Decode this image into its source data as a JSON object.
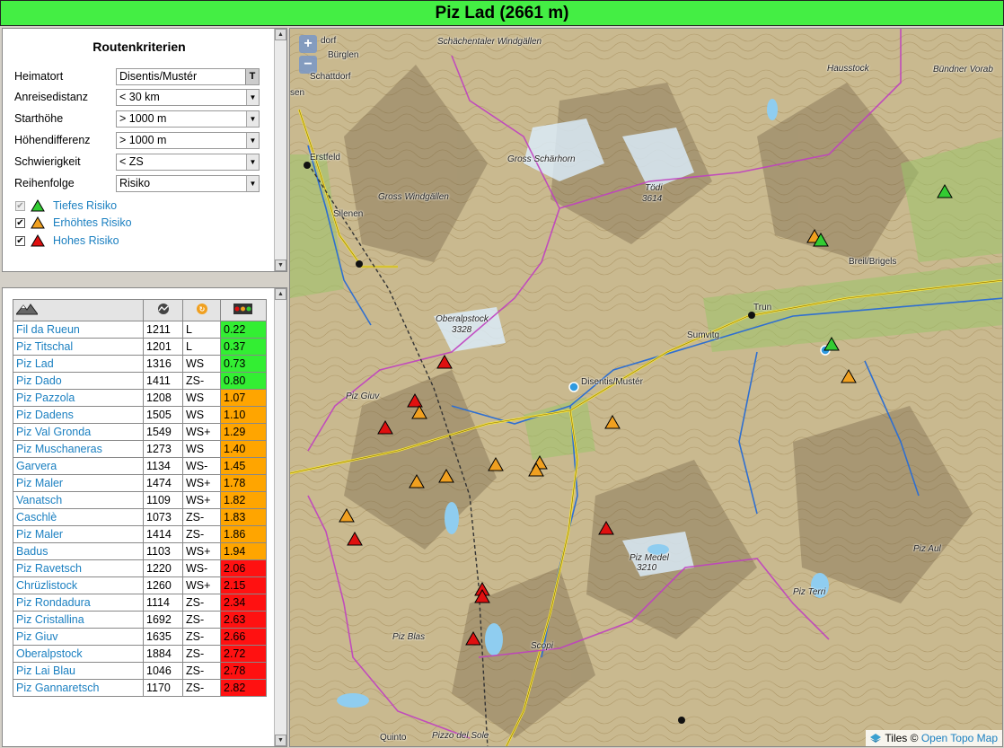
{
  "title": "Piz Lad (2661 m)",
  "criteria": {
    "heading": "Routenkriterien",
    "fields": [
      {
        "label": "Heimatort",
        "value": "Disentis/Mustér",
        "control": "T"
      },
      {
        "label": "Anreisedistanz",
        "value": "< 30 km"
      },
      {
        "label": "Starthöhe",
        "value": "> 1000 m"
      },
      {
        "label": "Höhendifferenz",
        "value": "> 1000 m"
      },
      {
        "label": "Schwierigkeit",
        "value": "< ZS"
      },
      {
        "label": "Reihenfolge",
        "value": "Risiko"
      }
    ],
    "risk_filters": [
      {
        "label": "Tiefes Risiko",
        "checked": true,
        "disabled": true,
        "color": "#33cc33"
      },
      {
        "label": "Erhöhtes Risiko",
        "checked": true,
        "disabled": false,
        "color": "#f0a020"
      },
      {
        "label": "Hohes Risiko",
        "checked": true,
        "disabled": false,
        "color": "#e01010"
      }
    ]
  },
  "results": {
    "header_icons": [
      "mountain-icon",
      "altitude-icon",
      "difficulty-icon",
      "traffic-light-icon"
    ],
    "rows": [
      {
        "name": "Fil da Rueun",
        "alt": "1211",
        "diff": "L",
        "risk": "0.22",
        "level": "low"
      },
      {
        "name": "Piz Titschal",
        "alt": "1201",
        "diff": "L",
        "risk": "0.37",
        "level": "low"
      },
      {
        "name": "Piz Lad",
        "alt": "1316",
        "diff": "WS",
        "risk": "0.73",
        "level": "low"
      },
      {
        "name": "Piz Dado",
        "alt": "1411",
        "diff": "ZS-",
        "risk": "0.80",
        "level": "low"
      },
      {
        "name": "Piz Pazzola",
        "alt": "1208",
        "diff": "WS",
        "risk": "1.07",
        "level": "mid"
      },
      {
        "name": "Piz Dadens",
        "alt": "1505",
        "diff": "WS",
        "risk": "1.10",
        "level": "mid"
      },
      {
        "name": "Piz Val Gronda",
        "alt": "1549",
        "diff": "WS+",
        "risk": "1.29",
        "level": "mid"
      },
      {
        "name": "Piz Muschaneras",
        "alt": "1273",
        "diff": "WS",
        "risk": "1.40",
        "level": "mid"
      },
      {
        "name": "Garvera",
        "alt": "1134",
        "diff": "WS-",
        "risk": "1.45",
        "level": "mid"
      },
      {
        "name": "Piz Maler",
        "alt": "1474",
        "diff": "WS+",
        "risk": "1.78",
        "level": "mid"
      },
      {
        "name": "Vanatsch",
        "alt": "1109",
        "diff": "WS+",
        "risk": "1.82",
        "level": "mid"
      },
      {
        "name": "Caschlè",
        "alt": "1073",
        "diff": "ZS-",
        "risk": "1.83",
        "level": "mid"
      },
      {
        "name": "Piz Maler",
        "alt": "1414",
        "diff": "ZS-",
        "risk": "1.86",
        "level": "mid"
      },
      {
        "name": "Badus",
        "alt": "1103",
        "diff": "WS+",
        "risk": "1.94",
        "level": "mid"
      },
      {
        "name": "Piz Ravetsch",
        "alt": "1220",
        "diff": "WS-",
        "risk": "2.06",
        "level": "high"
      },
      {
        "name": "Chrüzlistock",
        "alt": "1260",
        "diff": "WS+",
        "risk": "2.15",
        "level": "high"
      },
      {
        "name": "Piz Rondadura",
        "alt": "1114",
        "diff": "ZS-",
        "risk": "2.34",
        "level": "high"
      },
      {
        "name": "Piz Cristallina",
        "alt": "1692",
        "diff": "ZS-",
        "risk": "2.63",
        "level": "high"
      },
      {
        "name": "Piz Giuv",
        "alt": "1635",
        "diff": "ZS-",
        "risk": "2.66",
        "level": "high"
      },
      {
        "name": "Oberalpstock",
        "alt": "1884",
        "diff": "ZS-",
        "risk": "2.72",
        "level": "high"
      },
      {
        "name": "Piz Lai Blau",
        "alt": "1046",
        "diff": "ZS-",
        "risk": "2.78",
        "level": "high"
      },
      {
        "name": "Piz Gannaretsch",
        "alt": "1170",
        "diff": "ZS-",
        "risk": "2.82",
        "level": "high"
      }
    ]
  },
  "risk_colors": {
    "low": "#33ee33",
    "mid": "#ffa500",
    "high": "#ff1111"
  },
  "map": {
    "zoom_in": "+",
    "zoom_out": "−",
    "labels": [
      "Schächentaler Windgällen",
      "Bürglen",
      "Schattdorf",
      "Erstfeld",
      "Gross Schärhorn",
      "Gross Windgällen",
      "Tödi",
      "3614",
      "Silenen",
      "Hausstock",
      "Bündner Vorab",
      "Breil/Brigels",
      "Trun",
      "Sumvitg",
      "Oberalpstock",
      "3328",
      "Disentis/Mustér",
      "Piz Giuv",
      "Piz Medel",
      "3210",
      "Piz Terri",
      "Piz Aul",
      "Piz Blas",
      "Scopi",
      "Quinto",
      "Pizzo del Sole",
      "dorf",
      "sen"
    ],
    "attribution": {
      "prefix": "Tiles ©",
      "link": "Open Topo Map"
    }
  }
}
